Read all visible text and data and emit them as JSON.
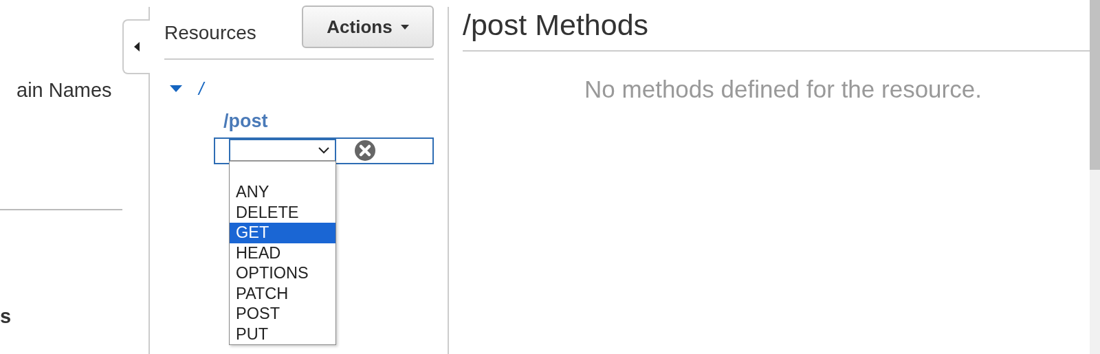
{
  "nav": {
    "items": [
      {
        "label": "ain Names",
        "bold": false
      },
      {
        "label": "s",
        "bold": true
      }
    ]
  },
  "resources": {
    "title": "Resources",
    "actions_button": "Actions",
    "tree": {
      "label": "/",
      "expanded": true,
      "children": [
        {
          "label": "/post"
        }
      ]
    },
    "method_select": {
      "options": [
        {
          "label": "ANY",
          "selected": false
        },
        {
          "label": "DELETE",
          "selected": false
        },
        {
          "label": "GET",
          "selected": true
        },
        {
          "label": "HEAD",
          "selected": false
        },
        {
          "label": "OPTIONS",
          "selected": false
        },
        {
          "label": "PATCH",
          "selected": false
        },
        {
          "label": "POST",
          "selected": false
        },
        {
          "label": "PUT",
          "selected": false
        }
      ]
    }
  },
  "methods": {
    "title": "/post Methods",
    "message": "No methods defined for the resource."
  }
}
